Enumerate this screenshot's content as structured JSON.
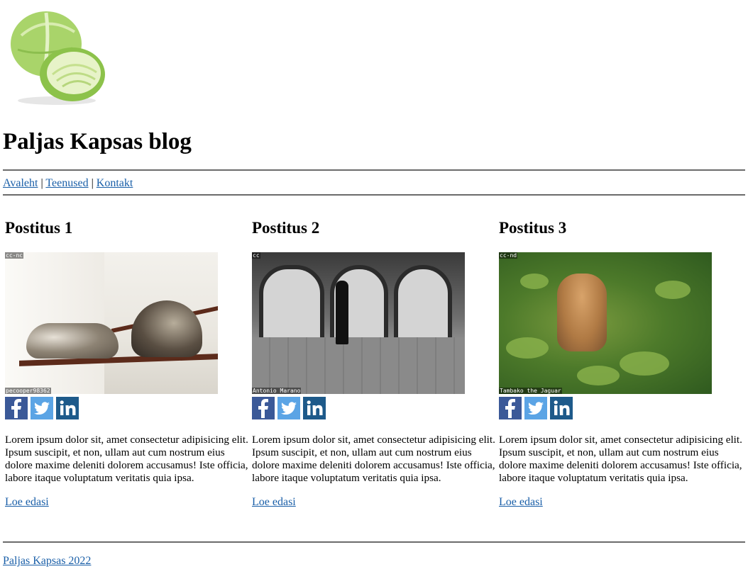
{
  "site": {
    "title": "Paljas Kapsas blog"
  },
  "nav": {
    "items": [
      "Avaleht",
      "Teenused",
      "Kontakt"
    ],
    "separator": "|"
  },
  "posts": [
    {
      "title": "Postitus 1",
      "image_credit_top": "cc-nc",
      "image_credit_bottom": "pecooper98362",
      "excerpt": "Lorem ipsum dolor sit, amet consectetur adipisicing elit. Ipsum suscipit, et non, ullam aut cum nostrum eius dolore maxime deleniti dolorem accusamus! Iste officia, labore itaque voluptatum veritatis quia ipsa.",
      "read_more": "Loe edasi"
    },
    {
      "title": "Postitus 2",
      "image_credit_top": "cc",
      "image_credit_bottom": "Antonio Marano",
      "excerpt": "Lorem ipsum dolor sit, amet consectetur adipisicing elit. Ipsum suscipit, et non, ullam aut cum nostrum eius dolore maxime deleniti dolorem accusamus! Iste officia, labore itaque voluptatum veritatis quia ipsa.",
      "read_more": "Loe edasi"
    },
    {
      "title": "Postitus 3",
      "image_credit_top": "cc-nd",
      "image_credit_bottom": "Tambako the Jaguar",
      "excerpt": "Lorem ipsum dolor sit, amet consectetur adipisicing elit. Ipsum suscipit, et non, ullam aut cum nostrum eius dolore maxime deleniti dolorem accusamus! Iste officia, labore itaque voluptatum veritatis quia ipsa.",
      "read_more": "Loe edasi"
    }
  ],
  "share_icons": [
    "facebook-icon",
    "twitter-icon",
    "linkedin-icon"
  ],
  "colors": {
    "link": "#1a5fa8",
    "facebook": "#3b5998",
    "twitter": "#5ba4e5",
    "linkedin": "#1e5a8a",
    "rule": "#6b6b6b"
  },
  "footer": {
    "text": "Paljas Kapsas 2022"
  }
}
